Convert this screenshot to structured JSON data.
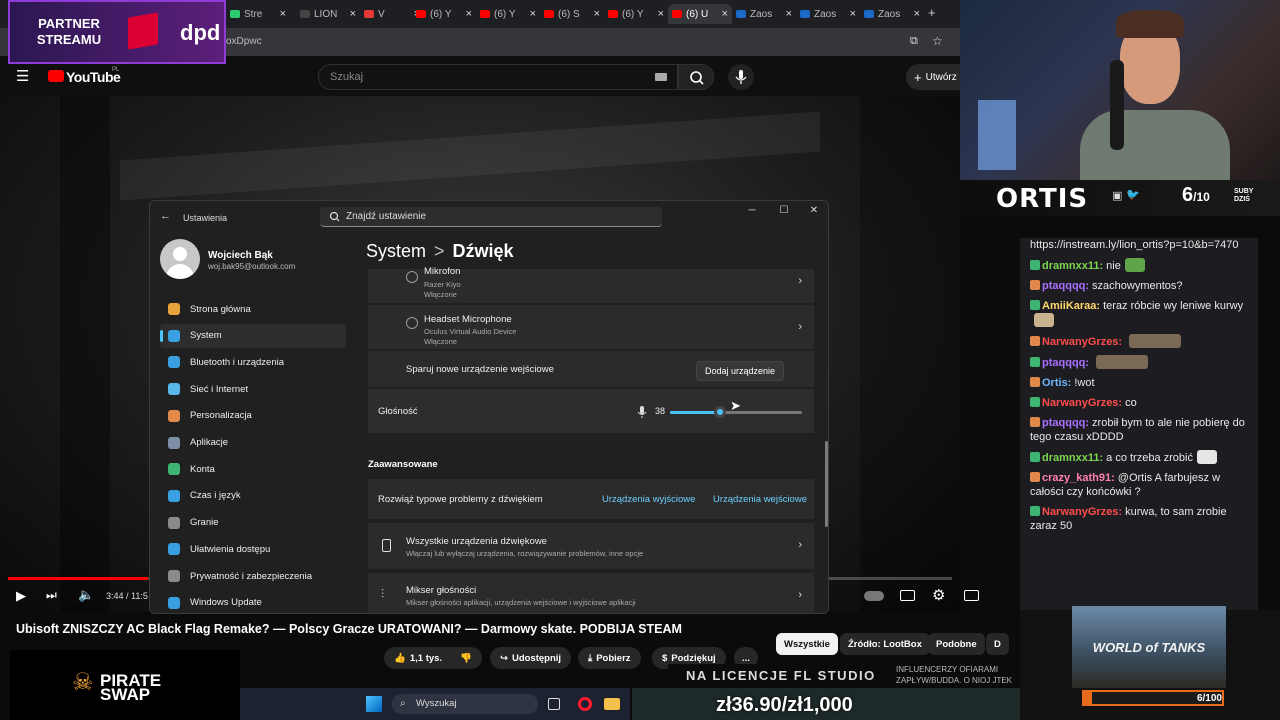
{
  "browser": {
    "tabs": [
      {
        "label": "Stre",
        "color": "#2ecc71"
      },
      {
        "label": "LION",
        "color": "#444444"
      },
      {
        "label": "V",
        "color": "#e53935"
      },
      {
        "label": "(6) Y",
        "color": "#ff0000"
      },
      {
        "label": "(6) Y",
        "color": "#ff0000"
      },
      {
        "label": "(6) S",
        "color": "#ff0000"
      },
      {
        "label": "(6) Y",
        "color": "#ff0000"
      },
      {
        "label": "(6) U",
        "color": "#ff0000"
      },
      {
        "label": "Zaos",
        "color": "#1b6ac9"
      },
      {
        "label": "Zaos",
        "color": "#1b6ac9"
      },
      {
        "label": "Zaos",
        "color": "#1b6ac9"
      }
    ],
    "url_fragment": "oxDpwc",
    "new_tab": "+"
  },
  "youtube": {
    "logo": "YouTube",
    "region": "PL",
    "search_placeholder": "Szukaj",
    "create_label": "Utwórz",
    "player_time": "3:44 / 11:5",
    "video_title": "Ubisoft ZNISZCZY AC Black Flag Remake? — Polscy Gracze URATOWANI? — Darmowy skate. PODBIJA STEAM",
    "like_count": "1,1 tys.",
    "share_label": "Udostępnij",
    "download_label": "Pobierz",
    "thanks_label": "Podziękuj",
    "more_label": "...",
    "chips": [
      {
        "label": "Wszystkie",
        "selected": true
      },
      {
        "label": "Źródło: LootBox",
        "selected": false
      },
      {
        "label": "Podobne",
        "selected": false
      },
      {
        "label": "D",
        "selected": false
      }
    ]
  },
  "settings": {
    "app_title": "Ustawienia",
    "search_placeholder": "Znajdź ustawienie",
    "user_name": "Wojciech Bąk",
    "user_email": "woj.bak95@outlook.com",
    "nav": [
      {
        "label": "Strona główna",
        "color": "#e8a33d",
        "active": false
      },
      {
        "label": "System",
        "color": "#3a9fe0",
        "active": true
      },
      {
        "label": "Bluetooth i urządzenia",
        "color": "#3a9fe0",
        "active": false
      },
      {
        "label": "Sieć i Internet",
        "color": "#5ab8e8",
        "active": false
      },
      {
        "label": "Personalizacja",
        "color": "#e0894a",
        "active": false
      },
      {
        "label": "Aplikacje",
        "color": "#7d8ea6",
        "active": false
      },
      {
        "label": "Konta",
        "color": "#3fb573",
        "active": false
      },
      {
        "label": "Czas i język",
        "color": "#3a9fe0",
        "active": false
      },
      {
        "label": "Granie",
        "color": "#8a8a8a",
        "active": false
      },
      {
        "label": "Ułatwienia dostępu",
        "color": "#3a9fe0",
        "active": false
      },
      {
        "label": "Prywatność i zabezpieczenia",
        "color": "#8a8a8a",
        "active": false
      },
      {
        "label": "Windows Update",
        "color": "#3a9fe0",
        "active": false
      }
    ],
    "breadcrumb_parent": "System",
    "breadcrumb_sep": ">",
    "breadcrumb_current": "Dźwięk",
    "devices": [
      {
        "name": "Mikrofon",
        "sub": "Razer Kiyo",
        "status": "Włączone"
      },
      {
        "name": "Headset Microphone",
        "sub": "Oculus Virtual Audio Device",
        "status": "Włączone"
      }
    ],
    "pair_label": "Sparuj nowe urządzenie wejściowe",
    "add_device": "Dodaj urządzenie",
    "volume_label": "Głośność",
    "volume_value": "38",
    "volume_fraction": 0.38,
    "advanced": "Zaawansowane",
    "troubleshoot": "Rozwiąż typowe problemy z dźwiękiem",
    "link_output": "Urządzenia wyjściowe",
    "link_output2": "Urządzenia wejściowe",
    "all_devices_title": "Wszystkie urządzenia dźwiękowe",
    "all_devices_sub": "Włączaj lub wyłączaj urządzenia, rozwiązywanie problemów, inne opcje",
    "mixer_title": "Mikser głośności",
    "mixer_sub": "Mikser głośności aplikacji, urządzenia wejściowe i wyjściowe aplikacji"
  },
  "overlay": {
    "partner_text": "PARTNER STREAMU",
    "sponsor": "dpd",
    "streamer": "ORTIS",
    "subs_count": "6",
    "subs_goal": "/10",
    "subs_label": "SUBY DZIŚ",
    "wot_title": "WORLD of TANKS",
    "wot_count": "6/100",
    "wot_fraction": 0.06,
    "pirate": "PIRATE SWAP",
    "fl_banner": "NA LICENCJE FL STUDIO",
    "ticker": "INFLUENCERZY OFIARAMI ZAPŁYW/BUDDA. O NIOJ JTEK",
    "price": "zł36.90/zł1,000",
    "taskbar_search": "Wyszukaj"
  },
  "chat": [
    {
      "user": "",
      "color": "#ffffff",
      "text": "https://instream.ly/lion_ortis?p=10&b=7470"
    },
    {
      "user": "dramnxx11:",
      "color": "#7cd64f",
      "text": "nie"
    },
    {
      "user": "ptaqqqq:",
      "color": "#a970ff",
      "text": "szachowymentos?"
    },
    {
      "user": "AmiiKaraa:",
      "color": "#ffd86b",
      "text": "teraz róbcie wy leniwe kurwy"
    },
    {
      "user": "NarwanyGrzes:",
      "color": "#ff4d4d",
      "text": ""
    },
    {
      "user": "ptaqqqq:",
      "color": "#a970ff",
      "text": ""
    },
    {
      "user": "Ortis:",
      "color": "#6fb6ff",
      "text": "!wot"
    },
    {
      "user": "NarwanyGrzes:",
      "color": "#ff4d4d",
      "text": "co"
    },
    {
      "user": "ptaqqqq:",
      "color": "#a970ff",
      "text": "zrobił bym to ale nie pobierę do tego czasu xDDDD"
    },
    {
      "user": "dramnxx11:",
      "color": "#7cd64f",
      "text": "a co trzeba zrobić"
    },
    {
      "user": "crazy_kath91:",
      "color": "#ff7fb0",
      "text": "@Ortis A farbujesz w całości czy końcówki ?"
    },
    {
      "user": "NarwanyGrzes:",
      "color": "#ff4d4d",
      "text": "kurwa, to sam zrobie zaraz 50"
    }
  ]
}
